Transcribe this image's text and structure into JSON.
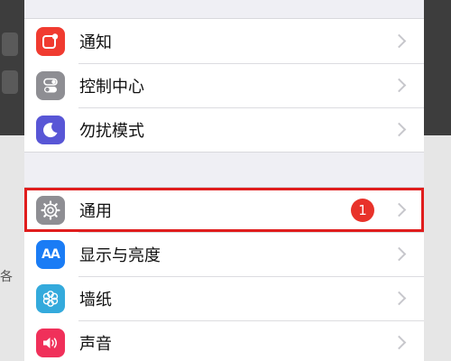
{
  "settings": {
    "group1": [
      {
        "label": "通知",
        "icon": "notifications-icon",
        "color": "#f03b30"
      },
      {
        "label": "控制中心",
        "icon": "control-center-icon",
        "color": "#8e8e93"
      },
      {
        "label": "勿扰模式",
        "icon": "do-not-disturb-icon",
        "color": "#5856d6"
      }
    ],
    "group2": [
      {
        "label": "通用",
        "icon": "gear-icon",
        "color": "#8e8e93",
        "badge": "1",
        "highlighted": true
      },
      {
        "label": "显示与亮度",
        "icon": "display-brightness-icon",
        "color": "#1a7cf5",
        "icon_text": "AA"
      },
      {
        "label": "墙纸",
        "icon": "wallpaper-icon",
        "color": "#34aadc"
      },
      {
        "label": "声音",
        "icon": "sounds-icon",
        "color": "#f0305a"
      }
    ]
  },
  "backdrop": {
    "partial_char": "各"
  }
}
